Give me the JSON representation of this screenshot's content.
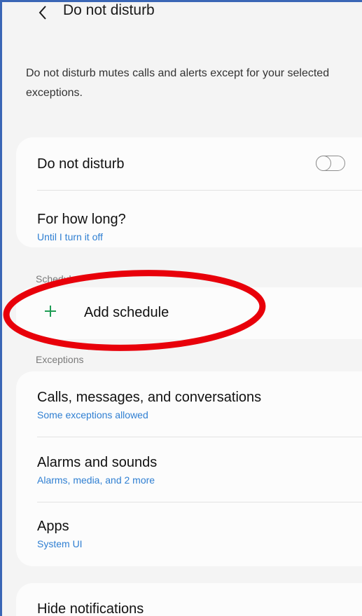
{
  "header": {
    "title": "Do not disturb",
    "back_icon": "chevron-left-icon"
  },
  "description": "Do not disturb mutes calls and alerts except for your selected exceptions.",
  "dnd_card": {
    "toggle_row": {
      "label": "Do not disturb",
      "toggle_on": false
    },
    "duration_row": {
      "label": "For how long?",
      "value": "Until I turn it off"
    }
  },
  "schedule_section": {
    "label": "Schedule",
    "add_label": "Add schedule",
    "add_icon": "plus-icon"
  },
  "exceptions_section": {
    "label": "Exceptions",
    "items": [
      {
        "title": "Calls, messages, and conversations",
        "subtitle": "Some exceptions allowed"
      },
      {
        "title": "Alarms and sounds",
        "subtitle": "Alarms, media, and 2 more"
      },
      {
        "title": "Apps",
        "subtitle": "System UI"
      }
    ]
  },
  "hide_notifications": {
    "label": "Hide notifications"
  },
  "colors": {
    "accent_blue": "#2f7fd2",
    "plus_green": "#1f9d55",
    "annotation_red": "#e8000a",
    "frame_blue": "#3a66b5"
  }
}
